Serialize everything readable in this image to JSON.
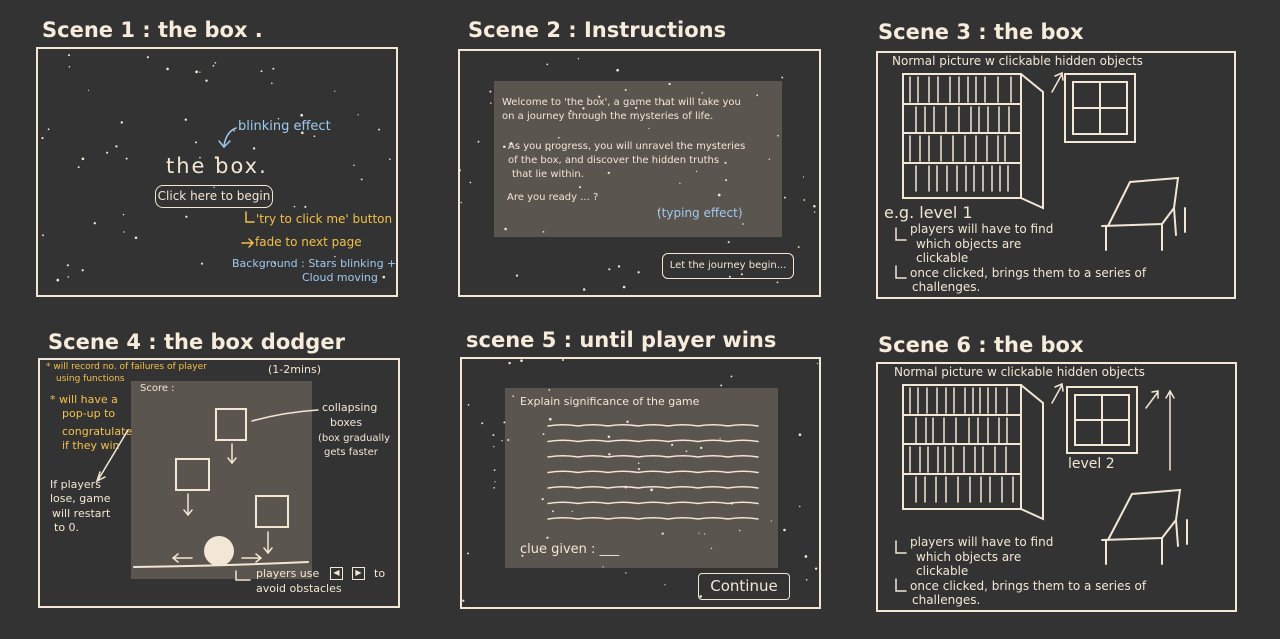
{
  "scene1": {
    "title": "Scene 1 : the box .",
    "blink_note": "blinking effect",
    "heading": "the box.",
    "button": "Click here to begin",
    "note1": "'try to click me' button",
    "note2": "fade to next page",
    "bg_note_l1": "Background : Stars blinking +",
    "bg_note_l2": "Cloud moving"
  },
  "scene2": {
    "title": "Scene 2 : Instructions",
    "para1_l1": "Welcome to 'the box', a game that will take you",
    "para1_l2": "on a journey through the mysteries of life.",
    "para2_l1": "As you progress, you will unravel the mysteries",
    "para2_l2": "of the box, and discover the hidden truths",
    "para2_l3": "that lie within.",
    "para3": "Are you ready ... ?",
    "typing_note": "(typing effect)",
    "button": "Let the journey begin..."
  },
  "scene3": {
    "title": "Scene 3 : the box",
    "caption": "Normal picture w clickable hidden objects",
    "level": "e.g. level 1",
    "note1_l1": "players will have to find",
    "note1_l2": "which objects are",
    "note1_l3": "clickable",
    "note2_l1": "once clicked, brings them to a series of",
    "note2_l2": "challenges."
  },
  "scene4": {
    "title": "Scene 4 : the box dodger",
    "duration": "(1-2mins)",
    "note_a_l1": "* will record no. of failures of player",
    "note_a_l2": "using functions",
    "note_b_l1": "* will have a",
    "note_b_l2": "pop-up to",
    "note_b_l3": "congratulate",
    "note_b_l4": "if they win",
    "note_c_l1": "If players",
    "note_c_l2": "lose, game",
    "note_c_l3": "will restart",
    "note_c_l4": "to 0.",
    "score": "Score :",
    "collapse_l1": "collapsing",
    "collapse_l2": "boxes",
    "collapse_l3": "(box gradually",
    "collapse_l4": "gets faster",
    "controls_l1": "players use",
    "controls_l1b": "to",
    "controls_l2": "avoid obstacles"
  },
  "scene5": {
    "title": "scene 5 : until player wins",
    "explain": "Explain significance of the game",
    "clue": "clue given : ___",
    "button": "Continue"
  },
  "scene6": {
    "title": "Scene 6 : the box",
    "caption": "Normal picture w clickable hidden objects",
    "level": "level 2",
    "note1_l1": "players will have to find",
    "note1_l2": "which objects are",
    "note1_l3": "clickable",
    "note2_l1": "once clicked, brings them to a series of",
    "note2_l2": "challenges."
  },
  "colors": {
    "background": "#333333",
    "line": "#f2e6d4",
    "panel": "#5b554f",
    "blue_note": "#9ec9ef",
    "yellow_note": "#f2c04a"
  }
}
